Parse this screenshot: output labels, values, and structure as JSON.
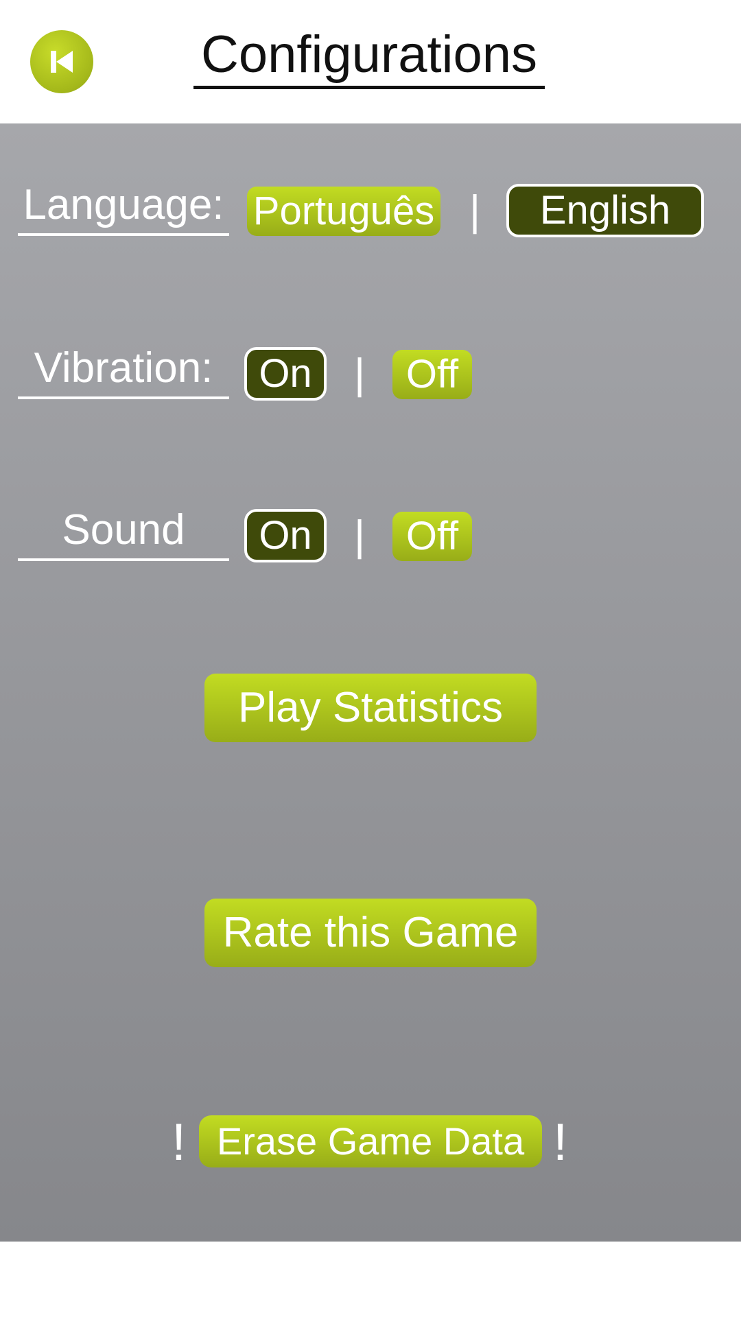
{
  "header": {
    "title": "Configurations",
    "back_icon": "skip-back-icon"
  },
  "language": {
    "label": "Language:",
    "options": [
      "Português",
      "English"
    ],
    "separator": "|",
    "selected": "English"
  },
  "vibration": {
    "label": "Vibration:",
    "on_label": "On",
    "off_label": "Off",
    "separator": "|",
    "selected": "On"
  },
  "sound": {
    "label": "Sound",
    "on_label": "On",
    "off_label": "Off",
    "separator": "|",
    "selected": "On"
  },
  "actions": {
    "play_statistics": "Play Statistics",
    "rate_game": "Rate this Game",
    "erase_data": "Erase Game Data",
    "warning_mark": "!"
  },
  "colors": {
    "accent_green": "#b4cc1e",
    "selected_dark": "#3f4a0a",
    "panel_gray": "#97989c"
  }
}
